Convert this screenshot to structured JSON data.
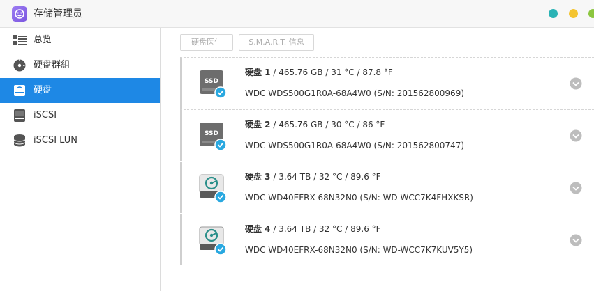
{
  "window": {
    "title": "存储管理员",
    "buttons": [
      "#2ab3b5",
      "#f4c430",
      "#8cc63f"
    ]
  },
  "sidebar": {
    "items": [
      {
        "label": "总览",
        "icon": "overview-list-icon",
        "active": false
      },
      {
        "label": "硬盘群組",
        "icon": "disk-group-icon",
        "active": false
      },
      {
        "label": "硬盘",
        "icon": "hard-drive-icon",
        "active": true
      },
      {
        "label": "iSCSI",
        "icon": "iscsi-icon",
        "active": false
      },
      {
        "label": "iSCSI LUN",
        "icon": "database-icon",
        "active": false
      }
    ]
  },
  "toolbar": {
    "doctor_label": "硬盘医生",
    "smart_label": "S.M.A.R.T. 信息"
  },
  "disks": [
    {
      "name": "硬盘 1",
      "info": " / 465.76 GB / 31 °C / 87.8 °F",
      "model": "WDC WDS500G1R0A-68A4W0 (S/N: 201562800969)",
      "type": "SSD"
    },
    {
      "name": "硬盘 2",
      "info": " / 465.76 GB / 30 °C / 86 °F",
      "model": "WDC WDS500G1R0A-68A4W0 (S/N: 201562800747)",
      "type": "SSD"
    },
    {
      "name": "硬盘 3",
      "info": " / 3.64 TB / 32 °C / 89.6 °F",
      "model": "WDC WD40EFRX-68N32N0 (S/N: WD-WCC7K4FHXKSR)",
      "type": "HDD"
    },
    {
      "name": "硬盘 4",
      "info": " / 3.64 TB / 32 °C / 89.6 °F",
      "model": "WDC WD40EFRX-68N32N0 (S/N: WD-WCC7K7KUV5Y5)",
      "type": "HDD"
    }
  ],
  "colors": {
    "accent": "#1e88e5",
    "status_ok": "#29a8e0"
  }
}
